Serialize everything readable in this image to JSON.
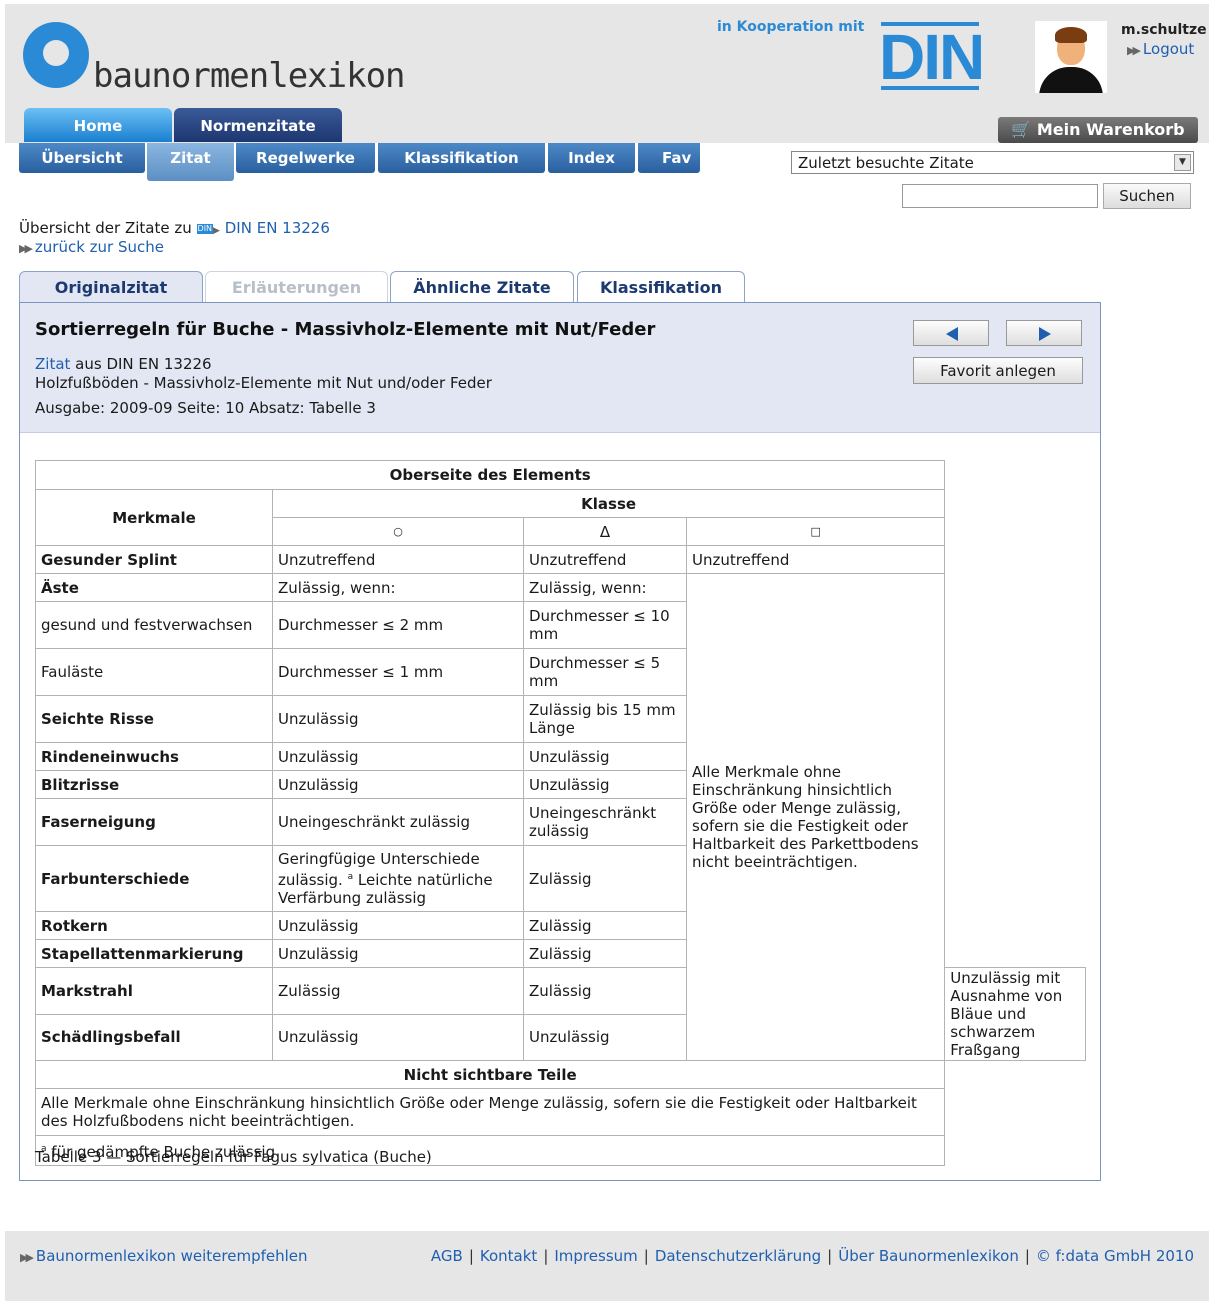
{
  "brand": {
    "name": "baunormenlexikon",
    "cooperation": "in Kooperation mit",
    "partner": "DIN"
  },
  "user": {
    "name": "m.schultze",
    "logout": "Logout"
  },
  "main_tabs": [
    {
      "label": "Home"
    },
    {
      "label": "Normenzitate"
    }
  ],
  "cart": {
    "label": "Mein Warenkorb"
  },
  "sub_tabs": [
    {
      "label": "Übersicht"
    },
    {
      "label": "Zitat"
    },
    {
      "label": "Regelwerke"
    },
    {
      "label": "Klassifikation"
    },
    {
      "label": "Index"
    },
    {
      "label": "Fav"
    }
  ],
  "recent": {
    "selected": "Zuletzt besuchte Zitate"
  },
  "search": {
    "value": "",
    "button": "Suchen"
  },
  "breadcrumb": {
    "prefix": "Übersicht der Zitate zu",
    "din_icon": "DIN",
    "norm": "DIN EN 13226",
    "back": "zurück zur Suche"
  },
  "content_tabs": [
    {
      "label": "Originalzitat"
    },
    {
      "label": "Erläuterungen"
    },
    {
      "label": "Ähnliche Zitate"
    },
    {
      "label": "Klassifikation"
    }
  ],
  "citation": {
    "title": "Sortierregeln für Buche - Massivholz-Elemente mit Nut/Feder",
    "source_link": "Zitat",
    "source_rest": " aus DIN EN 13226",
    "subtitle": "Holzfußböden - Massivholz-Elemente mit Nut und/oder Feder",
    "edition": "Ausgabe: 2009-09 Seite: 10 Absatz: Tabelle 3",
    "favorite_button": "Favorit anlegen"
  },
  "table": {
    "top_header": "Oberseite des Elements",
    "merkmale": "Merkmale",
    "klasse": "Klasse",
    "class_symbols": [
      "○",
      "Δ",
      "□"
    ],
    "rows": [
      {
        "name": "Gesunder Splint",
        "bold": true,
        "c1": "Unzutreffend",
        "c2": "Unzutreffend"
      },
      {
        "name": "Äste",
        "bold": true,
        "c1": "Zulässig, wenn:",
        "c2": "Zulässig, wenn:"
      },
      {
        "name": "gesund und festverwachsen",
        "bold": false,
        "c1": "Durchmesser ≤ 2 mm",
        "c2": "Durchmesser ≤ 10 mm"
      },
      {
        "name": "Fauläste",
        "bold": false,
        "c1": "Durchmesser ≤ 1 mm",
        "c2": "Durchmesser ≤ 5 mm"
      },
      {
        "name": "Seichte Risse",
        "bold": true,
        "c1": "Unzulässig",
        "c2": "Zulässig bis 15 mm Länge"
      },
      {
        "name": "Rindeneinwuchs",
        "bold": true,
        "c1": "Unzulässig",
        "c2": "Unzulässig"
      },
      {
        "name": "Blitzrisse",
        "bold": true,
        "c1": "Unzulässig",
        "c2": "Unzulässig"
      },
      {
        "name": "Faserneigung",
        "bold": true,
        "c1": "Uneingeschränkt zulässig",
        "c2": "Uneingeschränkt zulässig"
      },
      {
        "name": "Farbunterschiede",
        "bold": true,
        "c1_main": "Geringfügige Unterschiede zulässig.",
        "c1_sup": "a",
        "c1_rest": " Leichte natürliche Verfärbung zulässig",
        "c2": "Zulässig"
      },
      {
        "name": "Rotkern",
        "bold": true,
        "c1": "Unzulässig",
        "c2": "Zulässig"
      },
      {
        "name": "Stapellattenmarkierung",
        "bold": true,
        "c1": "Unzulässig",
        "c2": "Zulässig"
      },
      {
        "name": "Markstrahl",
        "bold": true,
        "c1": "Zulässig",
        "c2": "Zulässig"
      },
      {
        "name": "Schädlingsbefall",
        "bold": true,
        "c1": "Unzulässig",
        "c2": "Unzulässig"
      }
    ],
    "c3_span_a": "Unzutreffend",
    "c3_span_b": "Alle Merkmale ohne Einschränkung hinsichtlich Größe oder Menge zulässig, sofern sie die Festigkeit oder Haltbarkeit des Parkettbodens nicht beeinträchtigen.",
    "c3_span_c": "Unzulässig mit Ausnahme von Bläue und schwarzem Fraßgang",
    "hidden_header": "Nicht sichtbare Teile",
    "hidden_text": "Alle Merkmale ohne Einschränkung hinsichtlich Größe oder Menge zulässig, sofern sie die Festigkeit oder Haltbarkeit des Holzfußbodens nicht beeinträchtigen.",
    "footnote_sup": "a",
    "footnote_text": " für gedämpfte Buche zulässig",
    "caption": "Tabelle 3 — Sortierregeln für Fagus sylvatica (Buche)"
  },
  "footer": {
    "recommend": "Baunormenlexikon weiterempfehlen",
    "links": [
      "AGB",
      "Kontakt",
      "Impressum",
      "Datenschutzerklärung",
      "Über Baunormenlexikon",
      "© f:data GmbH 2010"
    ]
  },
  "colors": {
    "accent": "#2a8ad6",
    "nav_dark": "#1d3670",
    "panel_bg": "#e3e7f3",
    "link": "#1f5fb0"
  }
}
